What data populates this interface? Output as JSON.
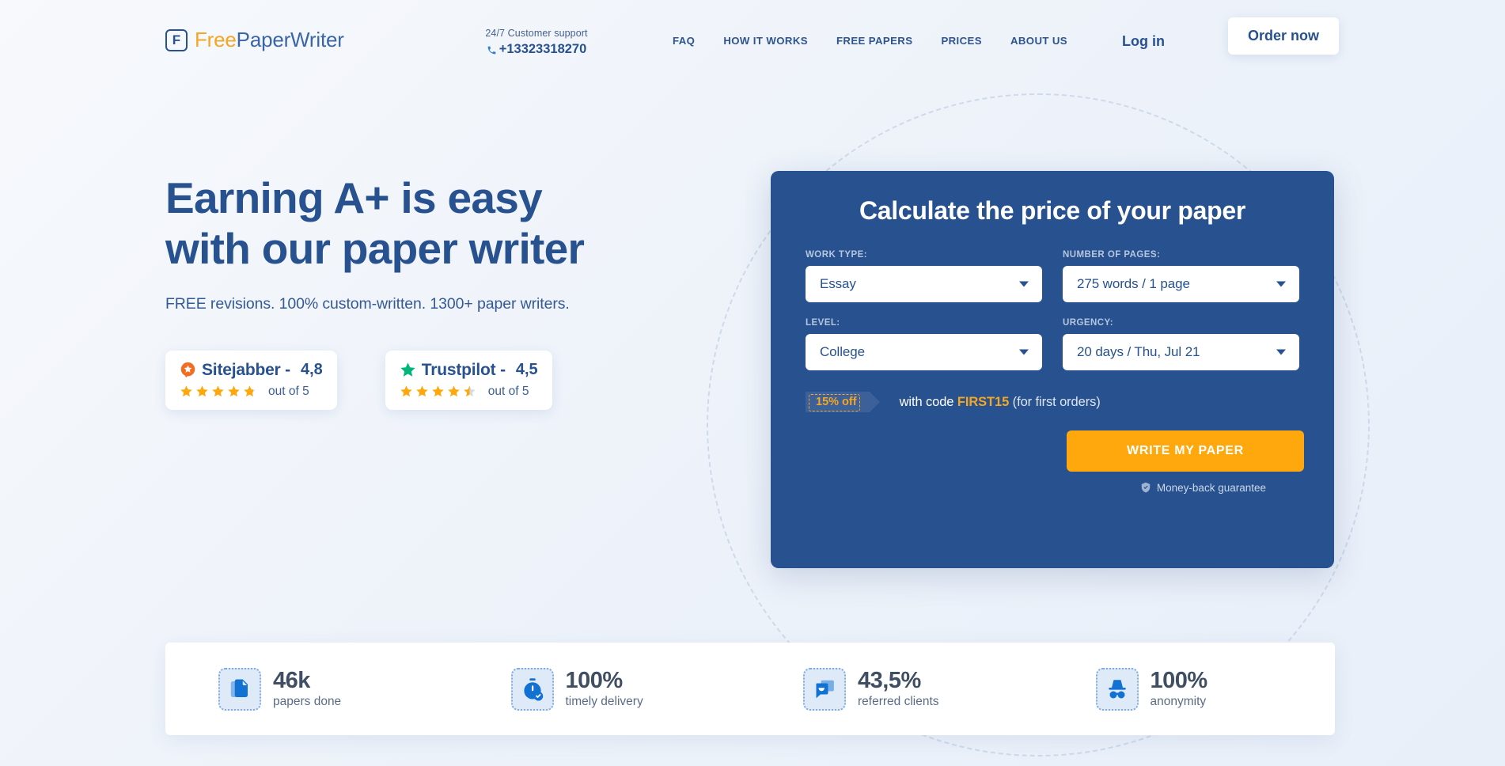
{
  "brand": {
    "mark": "F",
    "name_free": "Free",
    "name_rest": "PaperWriter"
  },
  "header": {
    "support_label": "24/7 Customer support",
    "support_phone": "+13323318270",
    "nav": [
      {
        "label": "FAQ"
      },
      {
        "label": "HOW IT WORKS"
      },
      {
        "label": "FREE PAPERS"
      },
      {
        "label": "PRICES"
      },
      {
        "label": "ABOUT US"
      }
    ],
    "login_label": "Log in",
    "order_label": "Order now"
  },
  "hero": {
    "title_line1": "Earning A+ is easy",
    "title_line2": "with our paper writer",
    "subtitle": "FREE revisions. 100% custom-written. 1300+ paper writers.",
    "badges": [
      {
        "icon": "sitejabber-icon",
        "name": "Sitejabber -",
        "score": "4,8",
        "out_of": "out of 5",
        "stars": 5,
        "half": true
      },
      {
        "icon": "trustpilot-star-icon",
        "name": "Trustpilot -",
        "score": "4,5",
        "out_of": "out of 5",
        "stars": 5,
        "half": true
      }
    ]
  },
  "calculator": {
    "title": "Calculate the price of your paper",
    "fields": [
      {
        "label": "WORK TYPE:",
        "value": "Essay"
      },
      {
        "label": "NUMBER OF PAGES:",
        "value": "275 words / 1 page"
      },
      {
        "label": "LEVEL:",
        "value": "College"
      },
      {
        "label": "URGENCY:",
        "value": "20 days / Thu, Jul 21"
      }
    ],
    "promo_badge": "15% off",
    "promo_prefix": "with code ",
    "promo_code": "FIRST15",
    "promo_suffix": " (for first orders)",
    "cta_label": "WRITE MY PAPER",
    "guarantee": "Money-back guarantee",
    "accent_blue": "#27518f",
    "accent_orange": "#ffa80d"
  },
  "stats": [
    {
      "icon": "documents-icon",
      "value": "46k",
      "label": "papers done"
    },
    {
      "icon": "stopwatch-check-icon",
      "value": "100%",
      "label": "timely delivery"
    },
    {
      "icon": "chat-smile-icon",
      "value": "43,5%",
      "label": "referred clients"
    },
    {
      "icon": "incognito-icon",
      "value": "100%",
      "label": "anonymity"
    }
  ]
}
